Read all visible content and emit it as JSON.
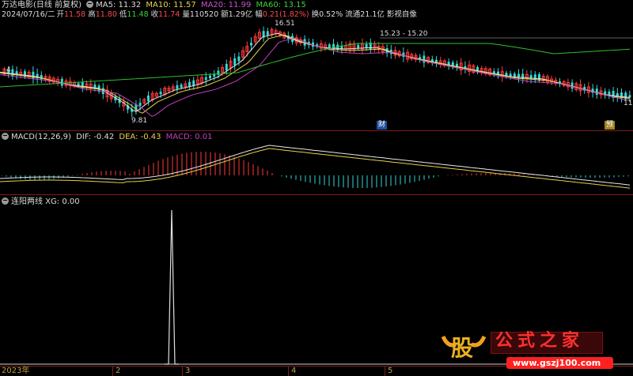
{
  "header": {
    "title": "万达电影(日线 前复权)",
    "ma_values": [
      {
        "label": "MA5: 11.32",
        "color": "#dcdcdc"
      },
      {
        "label": "MA10: 11.57",
        "color": "#e6d24a"
      },
      {
        "label": "MA20: 11.99",
        "color": "#d050d0"
      },
      {
        "label": "MA60: 13.15",
        "color": "#3ecf3e"
      }
    ]
  },
  "quote": {
    "date": "2024/07/16/二",
    "open_label": "开",
    "open": "11.58",
    "high_label": "高",
    "high": "11.80",
    "low_label": "低",
    "low": "11.48",
    "close_label": "收",
    "close": "11.74",
    "vol_label": "量",
    "vol": "110520",
    "amount_label": "额",
    "amount": "1.29亿",
    "change_label": "幅",
    "change": "0.21(1.82%)",
    "turnover": "换0.52%",
    "float": "流通21.1亿",
    "extra": "影视自像"
  },
  "price_annotations": {
    "high_mark": "16.51",
    "low_mark": "9.81",
    "range_mark": "15.23 - 15.20",
    "left_mark": "4",
    "right_mark": "11.",
    "badge_cai": "财",
    "badge_yu": "预"
  },
  "macd": {
    "label": "MACD(12,26,9)",
    "dif": "DIF: -0.42",
    "dea": "DEA: -0.43",
    "macd": "MACD: 0.01"
  },
  "indicator": {
    "label": "连阳两线 XG: 0.00"
  },
  "x_axis": {
    "labels": [
      "2023年",
      "2",
      "3",
      "4",
      "5"
    ]
  },
  "watermark": {
    "logo_char": "股",
    "text": "公式之家",
    "url": "www.gszj100.com"
  },
  "colors": {
    "up": "#ff3a3a",
    "down": "#35d6d6",
    "ma5": "#e0e0e0",
    "ma10": "#e6d24a",
    "ma20": "#c040c0",
    "ma60": "#2fbf2f",
    "separator": "#7a1e1e"
  }
}
